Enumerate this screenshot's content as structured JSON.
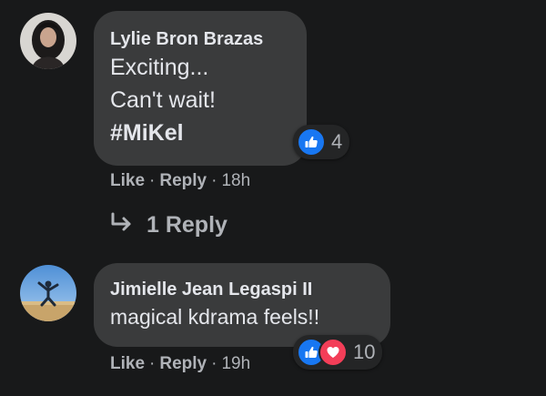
{
  "comments": [
    {
      "author": "Lylie Bron Brazas",
      "lines": [
        "Exciting...",
        "Can't wait!",
        "#MiKel"
      ],
      "reaction_count": "4",
      "reactions": [
        "like-icon"
      ],
      "actions": {
        "like": "Like",
        "reply": "Reply",
        "separator": "·",
        "time": "18h"
      },
      "replies_label": "1 Reply"
    },
    {
      "author": "Jimielle Jean Legaspi II",
      "lines": [
        "magical kdrama feels!!"
      ],
      "reaction_count": "10",
      "reactions": [
        "like-icon",
        "love-icon"
      ],
      "actions": {
        "like": "Like",
        "reply": "Reply",
        "separator": "·",
        "time": "19h"
      }
    }
  ],
  "colors": {
    "background": "#18191a",
    "bubble": "#3a3b3c",
    "text": "#e4e6eb",
    "secondary_text": "#b0b3b8",
    "like_blue": "#1877f2",
    "love_red": "#f33e58"
  }
}
